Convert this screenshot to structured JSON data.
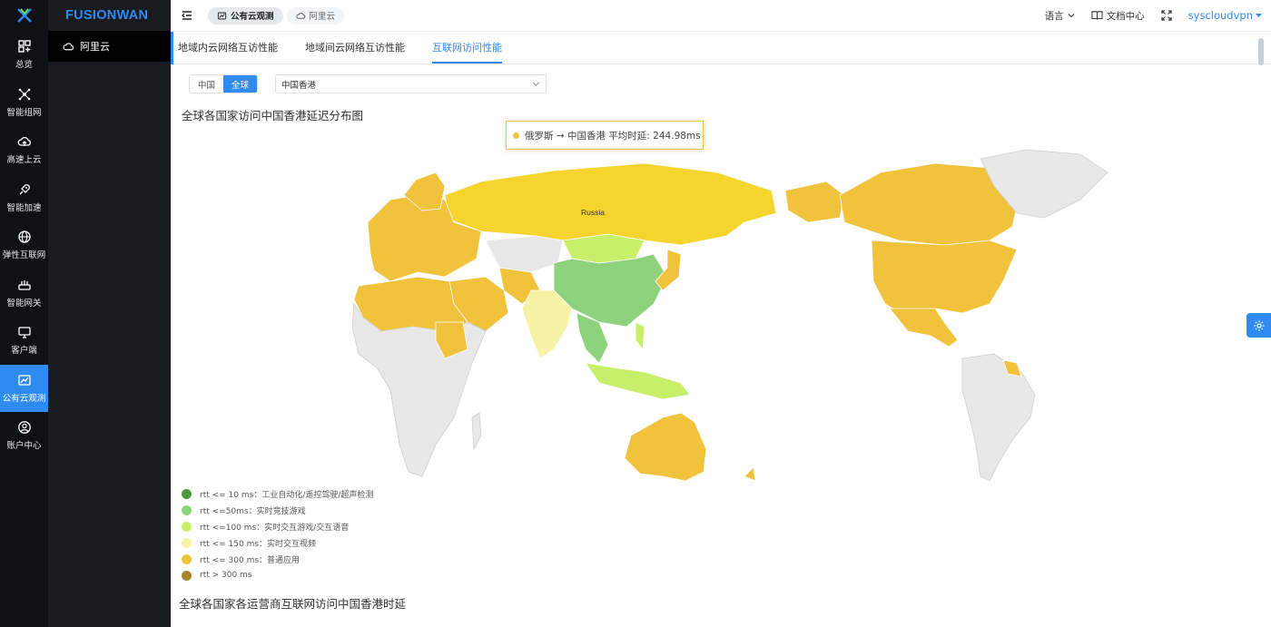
{
  "brand": "FUSIONWAN",
  "rail": [
    {
      "label": "总览",
      "icon": "dashboard-icon"
    },
    {
      "label": "智能组网",
      "icon": "network-icon"
    },
    {
      "label": "高速上云",
      "icon": "cloud-upload-icon"
    },
    {
      "label": "智能加速",
      "icon": "rocket-icon"
    },
    {
      "label": "弹性互联网",
      "icon": "globe-icon"
    },
    {
      "label": "智能网关",
      "icon": "router-icon"
    },
    {
      "label": "客户端",
      "icon": "monitor-icon"
    },
    {
      "label": "公有云观测",
      "icon": "chart-icon"
    },
    {
      "label": "账户中心",
      "icon": "user-icon"
    }
  ],
  "sub_menu": {
    "item": "阿里云"
  },
  "header": {
    "breadcrumbs": [
      "公有云观测",
      "阿里云"
    ],
    "lang": "语言",
    "docs": "文档中心",
    "user": "syscloudvpn"
  },
  "tabs": [
    "地域内云网络互访性能",
    "地域间云网络互访性能",
    "互联网访问性能"
  ],
  "active_tab": 2,
  "controls": {
    "segment": [
      "中国",
      "全球"
    ],
    "active_segment": 1,
    "select_value": "中国香港"
  },
  "map": {
    "title": "全球各国家访问中国香港延迟分布图",
    "label_russia": "Russia",
    "tooltip": "俄罗斯 → 中国香港 平均时延: 244.98ms"
  },
  "legend": [
    {
      "label": "rtt <= 10 ms：工业自动化/遥控驾驶/超声检测",
      "color": "#4e9a3b"
    },
    {
      "label": "rtt <=50ms：实时竞技游戏",
      "color": "#8fd27e"
    },
    {
      "label": "rtt <=100 ms：实时交互游戏/交互语音",
      "color": "#c7ef6a"
    },
    {
      "label": "rtt <= 150 ms：实时交互视频",
      "color": "#f7f3a6"
    },
    {
      "label": "rtt <= 300 ms：普通应用",
      "color": "#f1c23c"
    },
    {
      "label": "rtt > 300 ms",
      "color": "#a5862c"
    }
  ],
  "section2_title": "全球各国家各运营商互联网访问中国香港时延",
  "colors": {
    "accent": "#2f8bf0",
    "rail_bg": "#0f1115"
  }
}
